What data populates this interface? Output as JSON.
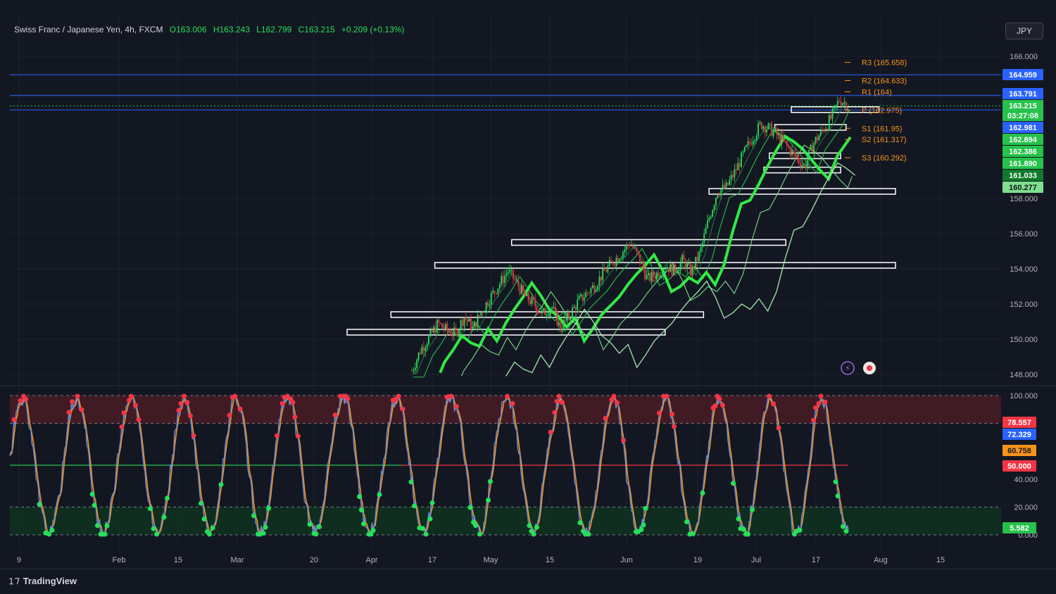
{
  "header": {
    "symbol": "Swiss Franc / Japanese Yen, 4h, FXCM",
    "open": "O163.006",
    "high": "H163.243",
    "low": "L162.799",
    "close": "C163.215",
    "change": "+0.209 (+0.13%)"
  },
  "currency_button": "JPY",
  "branding": "TradingView",
  "colors": {
    "background": "#131722",
    "up": "#26e05a",
    "down": "#f23645",
    "pivot": "#f7931a",
    "hline": "#2962ff",
    "stoch_k": "#6b8cce",
    "stoch_d": "#f7931a",
    "overbought_zone": "#4a1c25",
    "oversold_zone": "#0f3320"
  },
  "chart_data": [
    {
      "type": "candlestick",
      "title": "Swiss Franc / Japanese Yen, 4h, FXCM",
      "x_ticks": [
        "9",
        "Feb",
        "15",
        "Mar",
        "20",
        "Apr",
        "17",
        "May",
        "15",
        "Jun",
        "19",
        "Jul",
        "17",
        "Aug",
        "15"
      ],
      "y_ticks": [
        "166.000",
        "158.000",
        "156.000",
        "154.000",
        "152.000",
        "150.000",
        "148.000"
      ],
      "ylim": [
        147.8,
        167.2
      ],
      "price_series": [
        [
          0.0,
          148.2
        ],
        [
          0.02,
          149.4
        ],
        [
          0.04,
          150.1
        ],
        [
          0.06,
          150.9
        ],
        [
          0.08,
          150.5
        ],
        [
          0.1,
          150.3
        ],
        [
          0.12,
          151.3
        ],
        [
          0.14,
          150.6
        ],
        [
          0.16,
          151.6
        ],
        [
          0.18,
          152.4
        ],
        [
          0.2,
          153.1
        ],
        [
          0.22,
          153.9
        ],
        [
          0.24,
          153.2
        ],
        [
          0.26,
          152.4
        ],
        [
          0.28,
          152.0
        ],
        [
          0.3,
          151.4
        ],
        [
          0.32,
          151.9
        ],
        [
          0.34,
          150.6
        ],
        [
          0.36,
          151.3
        ],
        [
          0.38,
          152.1
        ],
        [
          0.4,
          152.6
        ],
        [
          0.42,
          153.1
        ],
        [
          0.44,
          153.8
        ],
        [
          0.46,
          154.4
        ],
        [
          0.48,
          154.9
        ],
        [
          0.5,
          155.5
        ],
        [
          0.52,
          154.6
        ],
        [
          0.54,
          153.4
        ],
        [
          0.56,
          153.7
        ],
        [
          0.58,
          154.2
        ],
        [
          0.6,
          153.9
        ],
        [
          0.62,
          154.5
        ],
        [
          0.64,
          153.8
        ],
        [
          0.66,
          154.9
        ],
        [
          0.68,
          156.8
        ],
        [
          0.7,
          158.4
        ],
        [
          0.72,
          158.6
        ],
        [
          0.74,
          159.5
        ],
        [
          0.76,
          160.5
        ],
        [
          0.78,
          161.4
        ],
        [
          0.8,
          162.2
        ],
        [
          0.82,
          161.9
        ],
        [
          0.84,
          161.5
        ],
        [
          0.86,
          160.9
        ],
        [
          0.88,
          160.3
        ],
        [
          0.9,
          159.8
        ],
        [
          0.92,
          161.1
        ],
        [
          0.94,
          161.8
        ],
        [
          0.96,
          162.5
        ],
        [
          0.98,
          163.6
        ],
        [
          1.0,
          163.2
        ]
      ],
      "price_labels": [
        {
          "value": "164.959",
          "color": "#2962ff"
        },
        {
          "value": "163.791",
          "color": "#2962ff"
        },
        {
          "value": "163.215",
          "color": "#26c24b"
        },
        {
          "value": "03:27:08",
          "color": "#26c24b"
        },
        {
          "value": "162.981",
          "color": "#2962ff"
        },
        {
          "value": "162.894",
          "color": "#26c24b"
        },
        {
          "value": "162.386",
          "color": "#26c24b"
        },
        {
          "value": "161.890",
          "color": "#26c24b"
        },
        {
          "value": "161.033",
          "color": "#0d7a2c"
        },
        {
          "value": "160.277",
          "color": "#7ee08d"
        }
      ],
      "horizontal_levels": [
        164.959,
        163.791,
        163.215,
        162.981
      ],
      "pivots": [
        {
          "label": "R3 (165.658)",
          "value": 165.658
        },
        {
          "label": "R2 (164.633)",
          "value": 164.633
        },
        {
          "label": "R1 (164)",
          "value": 164.0
        },
        {
          "label": "P (162.975)",
          "value": 162.975
        },
        {
          "label": "S1 (161.95)",
          "value": 161.95
        },
        {
          "label": "S2 (161.317)",
          "value": 161.317
        },
        {
          "label": "S3 (160.292)",
          "value": 160.292
        }
      ],
      "zones": [
        {
          "x0": 0.0,
          "x1": 0.58,
          "value": 150.4
        },
        {
          "x0": 0.08,
          "x1": 0.65,
          "value": 151.4
        },
        {
          "x0": 0.16,
          "x1": 1.0,
          "value": 154.2
        },
        {
          "x0": 0.3,
          "x1": 0.8,
          "value": 155.5
        },
        {
          "x0": 0.66,
          "x1": 1.0,
          "value": 158.4
        },
        {
          "x0": 0.76,
          "x1": 0.9,
          "value": 159.6
        },
        {
          "x0": 0.77,
          "x1": 0.9,
          "value": 160.4
        },
        {
          "x0": 0.78,
          "x1": 0.91,
          "value": 162.0
        },
        {
          "x0": 0.81,
          "x1": 0.97,
          "value": 163.0
        }
      ]
    },
    {
      "type": "line",
      "title": "",
      "y_ticks": [
        "100.000",
        "40.000",
        "20.000",
        "0.000"
      ],
      "ylim": [
        0,
        100
      ],
      "levels": [
        80,
        50,
        20
      ],
      "value_labels": [
        {
          "value": "78.557",
          "color": "#f23645"
        },
        {
          "value": "72.329",
          "color": "#2962ff"
        },
        {
          "value": "60.758",
          "color": "#f7931a"
        },
        {
          "value": "50.000",
          "color": "#f23645"
        },
        {
          "value": "5.582",
          "color": "#26c24b"
        }
      ]
    }
  ]
}
